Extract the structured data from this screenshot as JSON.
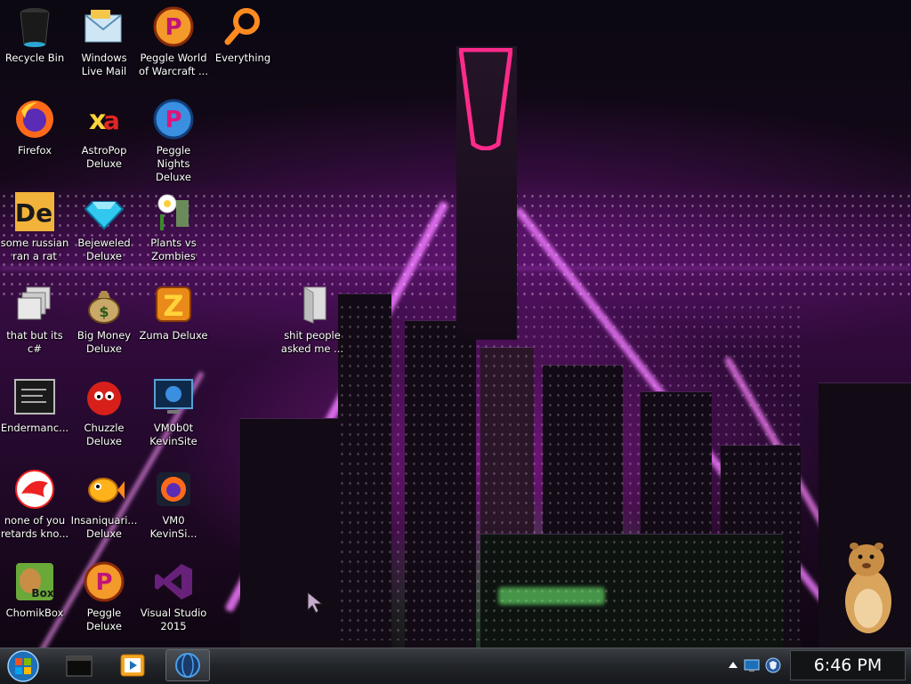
{
  "desktop": {
    "icons": [
      {
        "label": "Recycle Bin",
        "icon": "recycle-bin-icon"
      },
      {
        "label": "Windows Live Mail",
        "icon": "mail-icon"
      },
      {
        "label": "Peggle World of Warcraft ...",
        "icon": "peggle-icon"
      },
      {
        "label": "Everything",
        "icon": "magnifier-icon"
      },
      {
        "label": "Firefox",
        "icon": "firefox-icon"
      },
      {
        "label": "AstroPop Deluxe",
        "icon": "astropop-icon"
      },
      {
        "label": "Peggle Nights Deluxe",
        "icon": "peggle-icon"
      },
      {
        "label": "some russian ran a rat",
        "icon": "de-app-icon"
      },
      {
        "label": "Bejeweled Deluxe",
        "icon": "gem-icon"
      },
      {
        "label": "Plants vs Zombies",
        "icon": "plant-icon"
      },
      {
        "label": "that but its c#",
        "icon": "windows-stack-icon"
      },
      {
        "label": "Big Money Deluxe",
        "icon": "money-bag-icon"
      },
      {
        "label": "Zuma Deluxe",
        "icon": "zuma-icon"
      },
      {
        "label": "shit people asked me ...",
        "icon": "folder-icon"
      },
      {
        "label": "Endermanc...",
        "icon": "terminal-icon"
      },
      {
        "label": "Chuzzle Deluxe",
        "icon": "chuzzle-icon"
      },
      {
        "label": "VM0b0t KevinSite",
        "icon": "monitor-icon"
      },
      {
        "label": "none of you retards kno...",
        "icon": "lizard-icon"
      },
      {
        "label": "Insaniquari... Deluxe",
        "icon": "fish-icon"
      },
      {
        "label": "VM0 KevinSi...",
        "icon": "firefox-icon"
      },
      {
        "label": "ChomikBox",
        "icon": "hamster-box-icon"
      },
      {
        "label": "Peggle Deluxe",
        "icon": "peggle-icon"
      },
      {
        "label": "Visual Studio 2015",
        "icon": "visual-studio-icon"
      }
    ]
  },
  "taskbar": {
    "start_icon": "windows-orb-icon",
    "pinned": [
      {
        "icon": "cmd-window-icon"
      },
      {
        "icon": "media-player-icon"
      },
      {
        "icon": "globe-app-icon"
      }
    ],
    "tray": [
      "up-arrow-icon",
      "network-icon",
      "shield-icon"
    ],
    "clock": "6:46 PM"
  },
  "colors": {
    "neon_magenta": "#e040ff",
    "tower_pink": "#ff2a8a",
    "taskbar_dark": "#1d1f22"
  }
}
